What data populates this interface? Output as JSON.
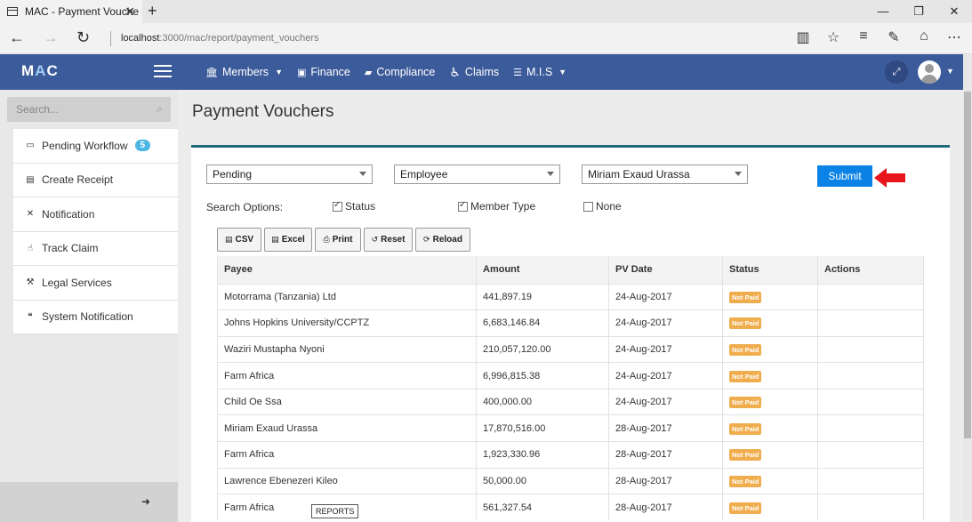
{
  "browser": {
    "tab_title": "MAC - Payment Vouche",
    "url_host": "localhost",
    "url_path": ":3000/mac/report/payment_vouchers"
  },
  "navbar": {
    "logo_m": "M",
    "logo_a": "A",
    "logo_c": "C",
    "menu": [
      {
        "label": "Members",
        "icon": "bank-icon",
        "caret": true
      },
      {
        "label": "Finance",
        "icon": "money-icon",
        "caret": false
      },
      {
        "label": "Compliance",
        "icon": "book-icon",
        "caret": false
      },
      {
        "label": "Claims",
        "icon": "wheelchair-icon",
        "caret": false
      },
      {
        "label": "M.I.S",
        "icon": "list-icon",
        "caret": true
      }
    ]
  },
  "sidebar": {
    "search_placeholder": "Search...",
    "items": [
      {
        "label": "Pending Workflow",
        "badge": "5"
      },
      {
        "label": "Create Receipt"
      },
      {
        "label": "Notification"
      },
      {
        "label": "Track Claim"
      },
      {
        "label": "Legal Services"
      },
      {
        "label": "System Notification"
      }
    ]
  },
  "page": {
    "title": "Payment Vouchers"
  },
  "filters": {
    "status_value": "Pending",
    "member_type_value": "Employee",
    "member_value": "Miriam Exaud Urassa",
    "submit_label": "Submit",
    "search_options_label": "Search Options:",
    "options": [
      {
        "label": "Status",
        "checked": true
      },
      {
        "label": "Member Type",
        "checked": true
      },
      {
        "label": "None",
        "checked": false
      }
    ]
  },
  "toolbar": {
    "csv": "CSV",
    "excel": "Excel",
    "print": "Print",
    "reset": "Reset",
    "reload": "Reload"
  },
  "table": {
    "headers": [
      "Payee",
      "Amount",
      "PV Date",
      "Status",
      "Actions"
    ],
    "rows": [
      {
        "payee": "Motorrama (Tanzania) Ltd",
        "amount": "441,897.19",
        "date": "24-Aug-2017",
        "status": "Not Paid"
      },
      {
        "payee": "Johns Hopkins University/CCPTZ",
        "amount": "6,683,146.84",
        "date": "24-Aug-2017",
        "status": "Not Paid"
      },
      {
        "payee": "Waziri Mustapha Nyoni",
        "amount": "210,057,120.00",
        "date": "24-Aug-2017",
        "status": "Not Paid"
      },
      {
        "payee": "Farm Africa",
        "amount": "6,996,815.38",
        "date": "24-Aug-2017",
        "status": "Not Paid"
      },
      {
        "payee": "Child Oe Ssa",
        "amount": "400,000.00",
        "date": "24-Aug-2017",
        "status": "Not Paid"
      },
      {
        "payee": "Miriam Exaud Urassa",
        "amount": "17,870,516.00",
        "date": "28-Aug-2017",
        "status": "Not Paid"
      },
      {
        "payee": "Farm Africa",
        "amount": "1,923,330.96",
        "date": "28-Aug-2017",
        "status": "Not Paid"
      },
      {
        "payee": "Lawrence Ebenezeri Kileo",
        "amount": "50,000.00",
        "date": "28-Aug-2017",
        "status": "Not Paid"
      },
      {
        "payee": "Farm Africa",
        "amount": "561,327.54",
        "date": "28-Aug-2017",
        "status": "Not Paid"
      }
    ]
  },
  "tooltip": "REPORTS",
  "colors": {
    "navbar": "#3c5b9a",
    "submit": "#0a82e6",
    "badge_not_paid": "#f0ad4e",
    "panel_accent": "#1e6a78",
    "arrow": "#e8141b"
  }
}
